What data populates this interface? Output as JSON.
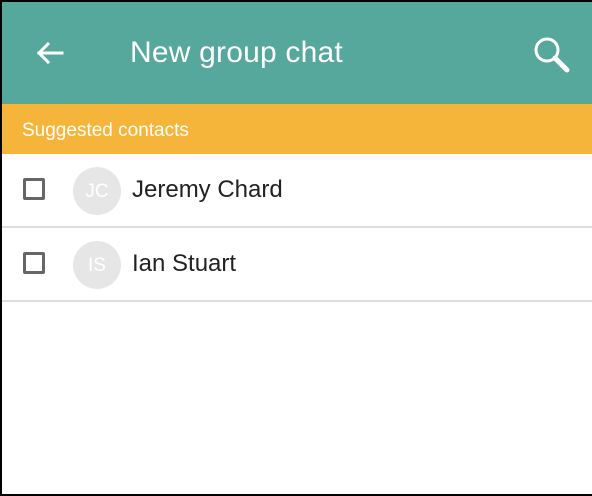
{
  "app_bar": {
    "title": "New group chat",
    "back_icon": "arrow-left-icon",
    "search_icon": "magnifier-icon",
    "background_color": "#56a79c"
  },
  "section": {
    "label": "Suggested contacts",
    "background_color": "#f5b43a"
  },
  "contacts": [
    {
      "initials": "JC",
      "name": "Jeremy Chard",
      "checked": false
    },
    {
      "initials": "IS",
      "name": "Ian Stuart",
      "checked": false
    }
  ]
}
